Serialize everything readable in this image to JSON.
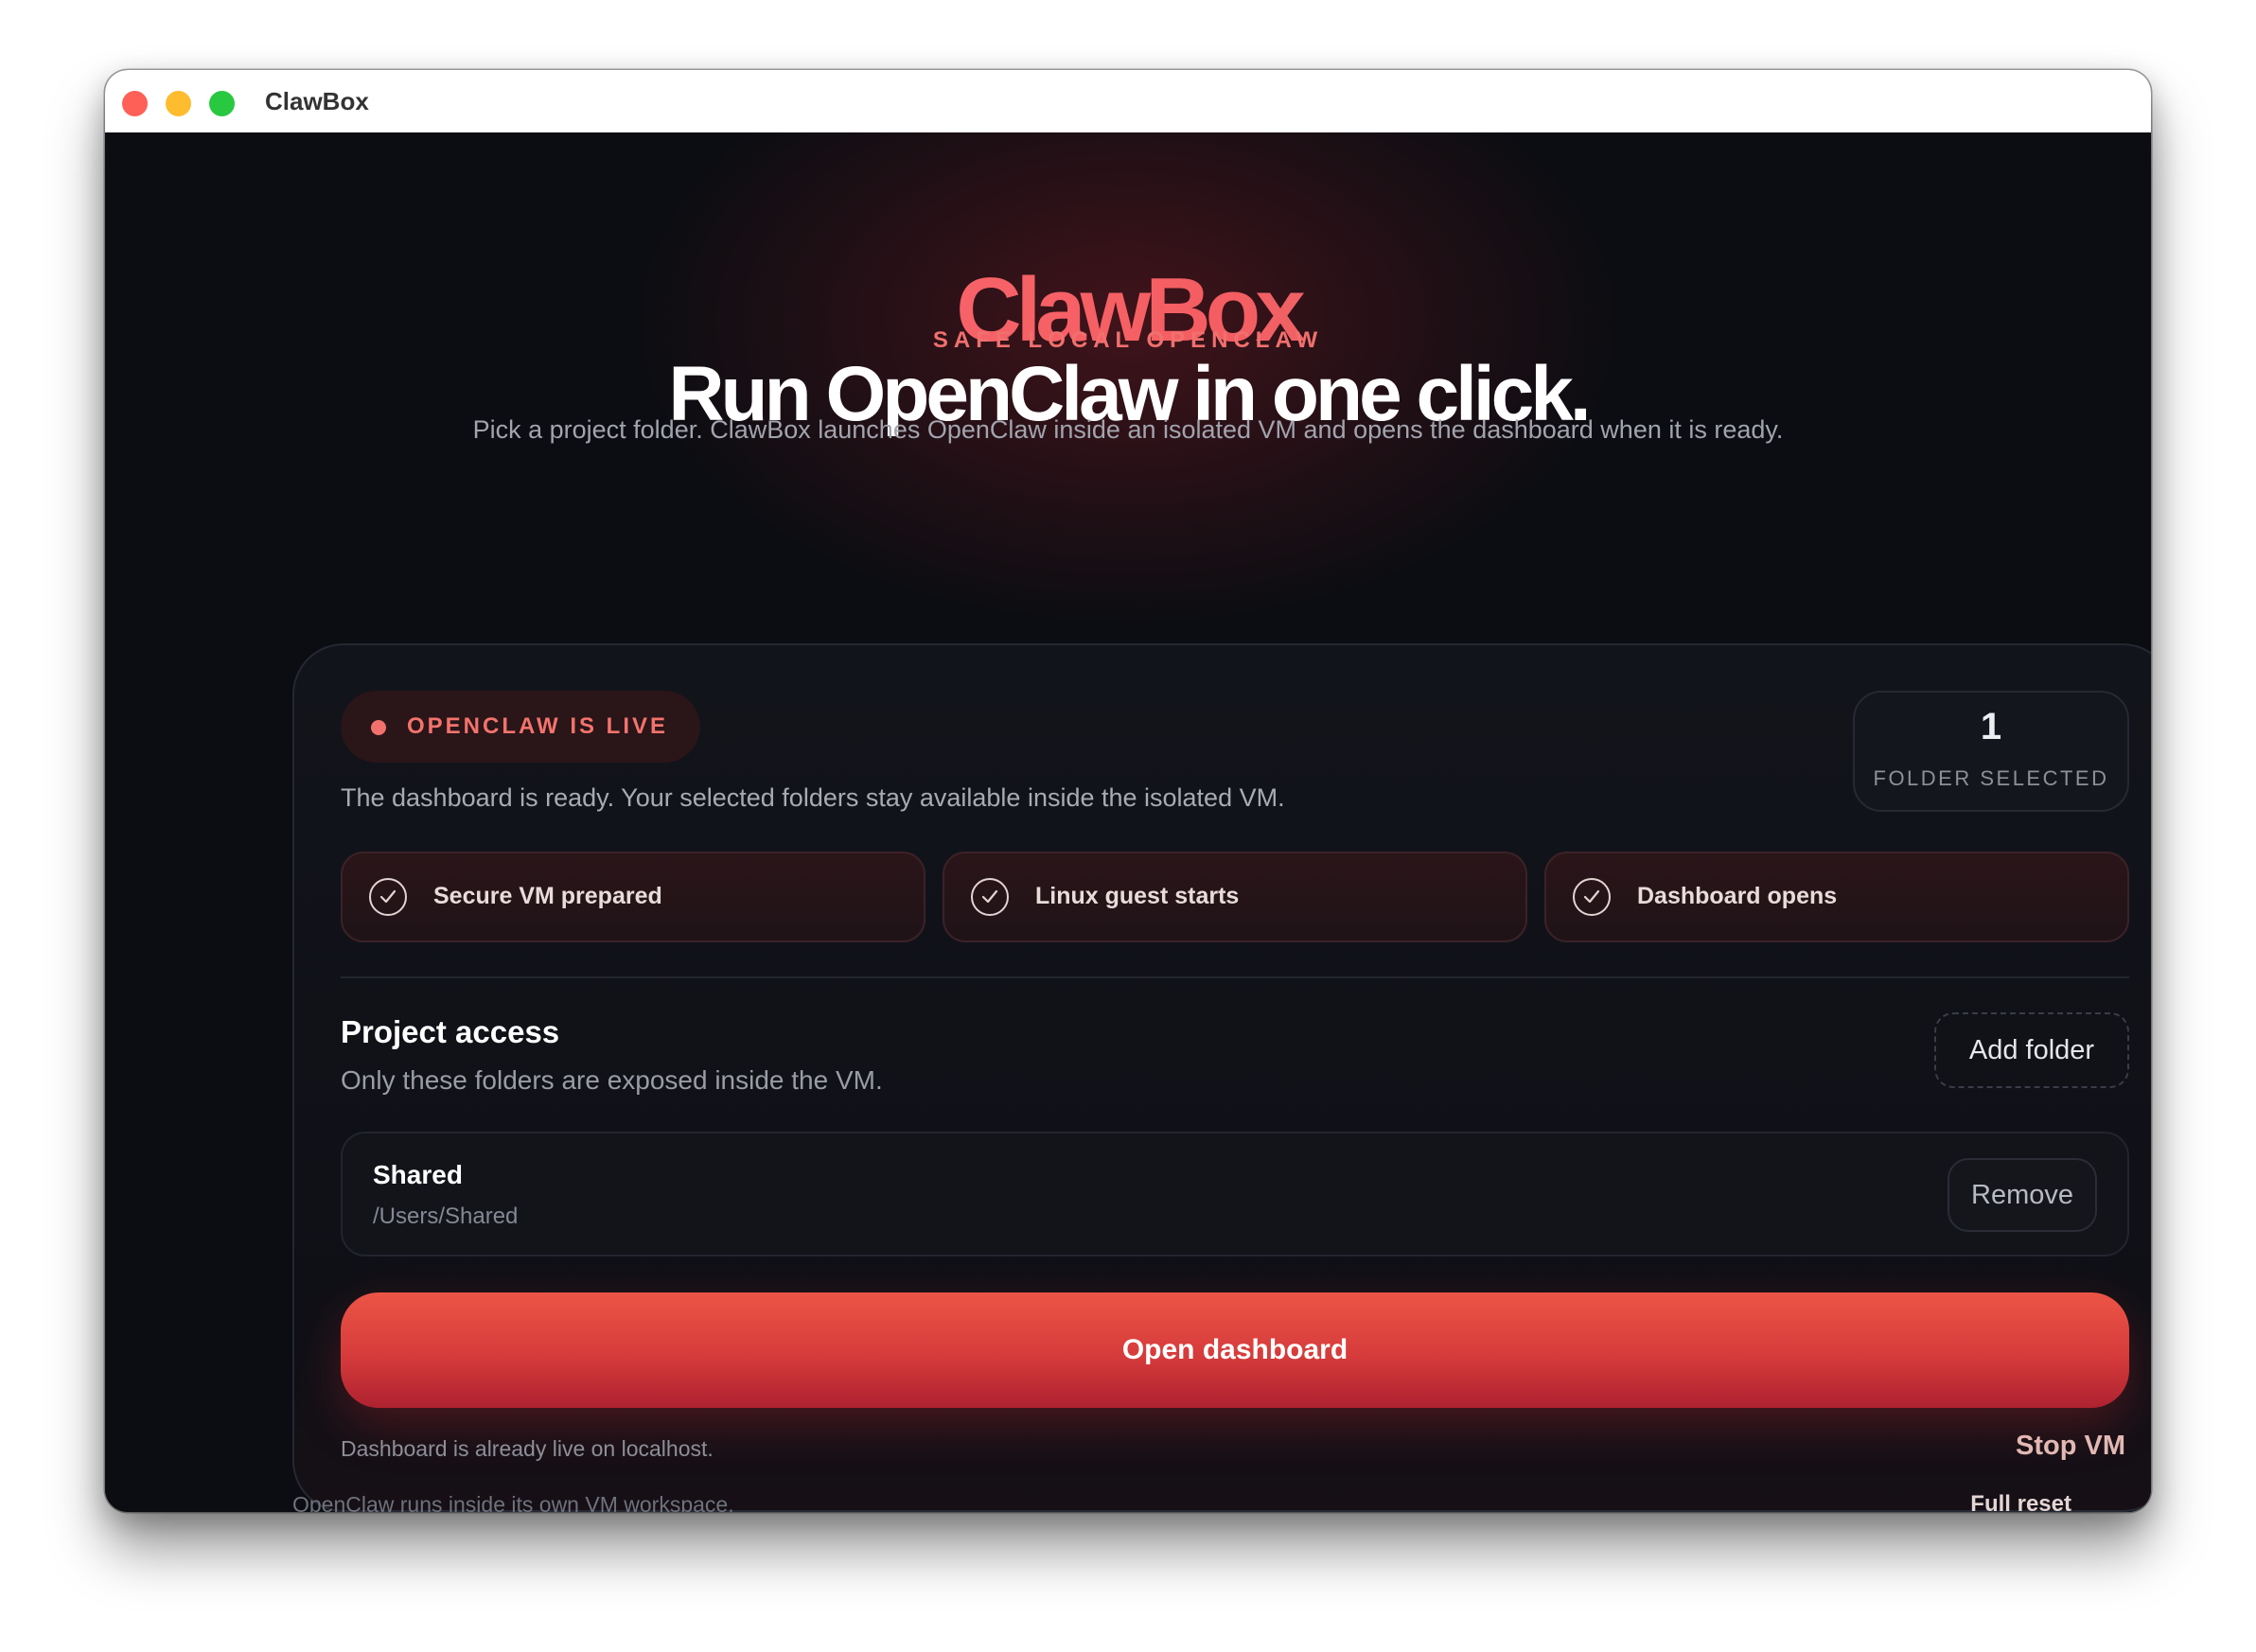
{
  "window": {
    "title": "ClawBox"
  },
  "hero": {
    "logo_text": "ClawBox",
    "eyebrow": "SAFE LOCAL OPENCLAW",
    "headline": "Run OpenClaw in one click.",
    "subline": "Pick a project folder. ClawBox launches OpenClaw inside an isolated VM and opens the dashboard when it is ready."
  },
  "status": {
    "badge": "OPENCLAW IS LIVE",
    "description": "The dashboard is ready. Your selected folders stay available inside the isolated VM.",
    "folder_count": "1",
    "folder_count_label": "FOLDER SELECTED"
  },
  "steps": [
    {
      "label": "Secure VM prepared",
      "icon": "check-circle-icon"
    },
    {
      "label": "Linux guest starts",
      "icon": "check-circle-icon"
    },
    {
      "label": "Dashboard opens",
      "icon": "check-circle-icon"
    }
  ],
  "project_access": {
    "title": "Project access",
    "description": "Only these folders are exposed inside the VM.",
    "add_folder_label": "Add folder",
    "folders": [
      {
        "name": "Shared",
        "path": "/Users/Shared",
        "remove_label": "Remove"
      }
    ]
  },
  "actions": {
    "open_dashboard_label": "Open dashboard",
    "live_note": "Dashboard is already live on localhost.",
    "stop_vm_label": "Stop VM"
  },
  "footer": {
    "note": "OpenClaw runs inside its own VM workspace.",
    "full_reset_label": "Full reset"
  },
  "colors": {
    "accent": "#f3716c",
    "primary_button": "#e24a40",
    "background": "#0c0d12"
  }
}
